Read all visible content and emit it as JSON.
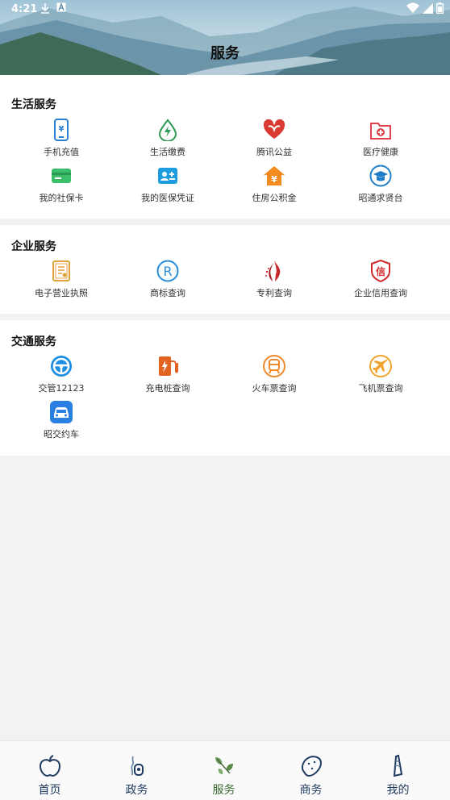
{
  "status_bar": {
    "time": "4:21"
  },
  "header": {
    "title": "服务"
  },
  "sections": [
    {
      "title": "生活服务",
      "items": [
        {
          "label": "手机充值",
          "icon": "phone-recharge-icon"
        },
        {
          "label": "生活缴费",
          "icon": "utility-bill-icon"
        },
        {
          "label": "腾讯公益",
          "icon": "charity-heart-icon"
        },
        {
          "label": "医疗健康",
          "icon": "medical-folder-icon"
        },
        {
          "label": "我的社保卡",
          "icon": "social-security-card-icon"
        },
        {
          "label": "我的医保凭证",
          "icon": "medical-insurance-card-icon"
        },
        {
          "label": "住房公积金",
          "icon": "housing-fund-icon"
        },
        {
          "label": "昭通求贤台",
          "icon": "graduation-cap-icon"
        }
      ]
    },
    {
      "title": "企业服务",
      "items": [
        {
          "label": "电子营业执照",
          "icon": "business-license-icon"
        },
        {
          "label": "商标查询",
          "icon": "trademark-icon"
        },
        {
          "label": "专利查询",
          "icon": "patent-icon"
        },
        {
          "label": "企业信用查询",
          "icon": "credit-shield-icon"
        }
      ]
    },
    {
      "title": "交通服务",
      "items": [
        {
          "label": "交管12123",
          "icon": "steering-wheel-icon"
        },
        {
          "label": "充电桩查询",
          "icon": "charging-pile-icon"
        },
        {
          "label": "火车票查询",
          "icon": "train-icon"
        },
        {
          "label": "飞机票查询",
          "icon": "airplane-icon"
        },
        {
          "label": "昭交约车",
          "icon": "taxi-icon"
        }
      ]
    }
  ],
  "tabbar": [
    {
      "label": "首页",
      "icon": "apple-home-icon"
    },
    {
      "label": "政务",
      "icon": "government-icon"
    },
    {
      "label": "服务",
      "icon": "service-leaves-icon",
      "active": true
    },
    {
      "label": "商务",
      "icon": "business-potato-icon"
    },
    {
      "label": "我的",
      "icon": "profile-icon"
    }
  ]
}
